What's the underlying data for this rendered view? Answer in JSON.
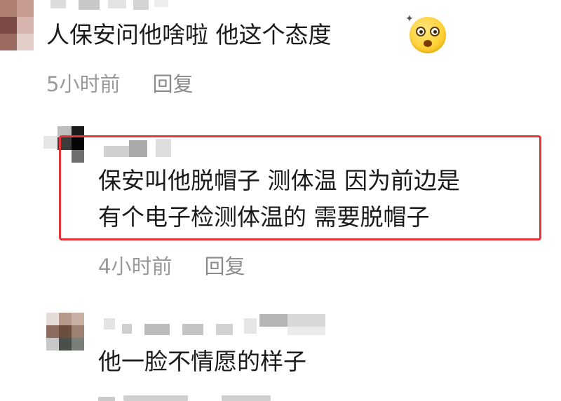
{
  "comments": [
    {
      "text": "人保安问他啥啦 他这个态度",
      "emoji": "shocked-face-emoji",
      "time": "5小时前",
      "reply_label": "回复"
    },
    {
      "text_line1": "保安叫他脱帽子 测体温 因为前边是",
      "text_line2": "有个电子检测体温的 需要脱帽子",
      "time": "4小时前",
      "reply_label": "回复",
      "highlight_color": "#e8323a"
    },
    {
      "text": "他一脸不情愿的样子"
    }
  ]
}
